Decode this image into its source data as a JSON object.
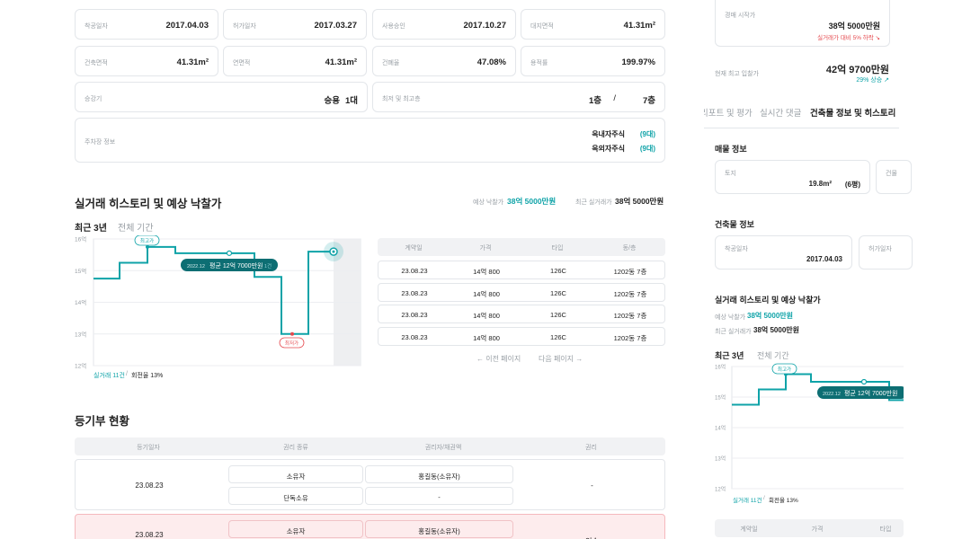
{
  "info": {
    "approval_date": {
      "label": "착공일자",
      "value": "2017.04.03"
    },
    "permit_date": {
      "label": "허가일자",
      "value": "2017.03.27"
    },
    "use_approval": {
      "label": "사용승인",
      "value": "2017.10.27"
    },
    "land_area": {
      "label": "대지면적",
      "value": "41.31m²"
    },
    "building_area": {
      "label": "건축면적",
      "value": "41.31m²"
    },
    "total_area": {
      "label": "연면적",
      "value": "41.31m²"
    },
    "coverage": {
      "label": "건폐율",
      "value": "47.08%"
    },
    "far": {
      "label": "용적률",
      "value": "199.97%"
    },
    "elevator": {
      "label": "승강기",
      "value_a": "승용",
      "value_b": "1대"
    },
    "floors": {
      "label": "최저 및 최고층",
      "low": "1층",
      "sep": "/",
      "high": "7층"
    },
    "parking": {
      "label": "주차장 정보",
      "indoor_label": "옥내자주식",
      "indoor_count": "(9대)",
      "outdoor_label": "옥외자주식",
      "outdoor_count": "(9대)"
    }
  },
  "history": {
    "title": "실거래 히스토리 및 예상 낙찰가",
    "expected_label": "예상 낙찰가",
    "expected_value": "38억 5000만원",
    "recent_label": "최근 실거래가",
    "recent_value": "38억 5000만원",
    "tabs": [
      "최근 3년",
      "전체 기간"
    ],
    "summary_count": "실거래 11건",
    "summary_sep": "/",
    "summary_rate": "회전율 13%",
    "tooltip_date": "2022.12",
    "tooltip_text": "평균 12억 7000만원",
    "tooltip_count": "1건",
    "max_badge": "최고가",
    "min_badge": "최저가",
    "prev_page": "이전 페이지",
    "next_page": "다음 페이지"
  },
  "chart_data": {
    "type": "line",
    "y_ticks": [
      "16억",
      "15억",
      "14억",
      "13억",
      "12억"
    ],
    "ylim": [
      12,
      16
    ],
    "points": [
      15.0,
      15.0,
      15.45,
      15.45,
      16.0,
      16.0,
      15.7,
      15.7,
      15.2,
      15.2,
      15.0,
      14.9
    ]
  },
  "trade_table": {
    "headers": [
      "계약일",
      "가격",
      "타입",
      "동/층"
    ],
    "rows": [
      [
        "23.08.23",
        "14억 800",
        "126C",
        "1202동 7층"
      ],
      [
        "23.08.23",
        "14억 800",
        "126C",
        "1202동 7층"
      ],
      [
        "23.08.23",
        "14억 800",
        "126C",
        "1202동 7층"
      ],
      [
        "23.08.23",
        "14억 800",
        "126C",
        "1202동 7층"
      ]
    ]
  },
  "registry": {
    "title": "등기부 현황",
    "headers": [
      "등기일자",
      "권리 종류",
      "권리자/채권액",
      "권리"
    ],
    "row1": {
      "date": "23.08.23",
      "type1": "소유자",
      "holder1": "홍길동(소유자)",
      "type2": "단독소유",
      "holder2": "-",
      "right": "-"
    },
    "row2": {
      "date": "23.08.23",
      "type1": "소유자",
      "holder1": "홍길동(소유자)",
      "right": "인수"
    }
  },
  "side": {
    "auction_label": "경매 시작가",
    "auction_value": "38억 5000만원",
    "auction_note": "실거래가 대비 5% 하락 ↘",
    "top_bid_label": "현재 최고 입찰가",
    "top_bid_value": "42억 9700만원",
    "top_bid_note": "29% 상승 ↗",
    "tabs": [
      "리포트 및 평가",
      "실시간 댓글",
      "건축물 정보 및 히스토리"
    ],
    "listing_title": "매물 정보",
    "land_label": "토지",
    "land_value": "19.8m²",
    "land_pyeong": "(6평)",
    "building_label": "건물",
    "building_info_title": "건축물 정보",
    "start_label": "착공일자",
    "start_value": "2017.04.03",
    "permit_label": "허가일자",
    "history_title": "실거래 히스토리 및 예상 낙찰가",
    "expected_label": "예상 낙찰가",
    "expected_value": "38억 5000만원",
    "recent_label": "최근 실거래가",
    "recent_value": "38억 5000만원",
    "chart_tabs": [
      "최근 3년",
      "전체 기간"
    ],
    "tooltip_date": "2022.12",
    "tooltip_text": "평균 12억 7000만원",
    "max_badge": "최고가",
    "y_ticks": [
      "16억",
      "15억",
      "14억",
      "13억",
      "12억"
    ],
    "summary_count": "실거래 11건",
    "summary_sep": "/",
    "summary_rate": "회전율 13%",
    "table_headers": [
      "계약일",
      "가격",
      "타입"
    ]
  },
  "colors": {
    "accent": "#0fa3a8",
    "accent_dark": "#0d6e73",
    "danger": "#e5484d",
    "border": "#e3e6ea"
  }
}
